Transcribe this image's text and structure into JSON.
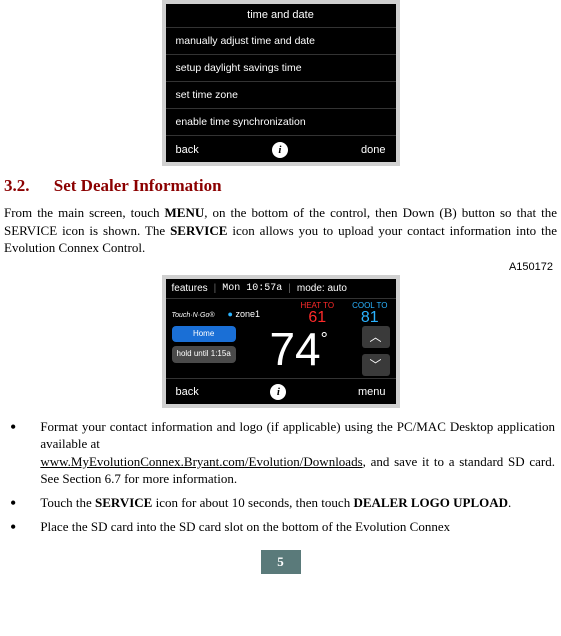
{
  "screenshot1": {
    "header": "time and date",
    "rows": [
      "manually adjust time and date",
      "setup daylight savings time",
      "set time zone",
      "enable time synchronization"
    ],
    "back": "back",
    "done": "done",
    "info_icon": "i"
  },
  "section": {
    "num": "3.2.",
    "title": "Set Dealer Information"
  },
  "para": {
    "p1a": "From the main screen, touch ",
    "p1b": "MENU",
    "p1c": ", on the bottom of the control, then Down (B) button so that the SERVICE icon is shown. The ",
    "p1d": "SERVICE",
    "p1e": " icon allows you to upload your contact information into the Evolution Connex Control."
  },
  "figref": "A150172",
  "screenshot2": {
    "features": "features",
    "clock": "Mon 10:57a",
    "mode_label": "mode: auto",
    "touchngo": "Touch·N·Go®",
    "zone_dot": "●",
    "zone": "zone1",
    "heat_label": "HEAT TO",
    "heat_val": "61",
    "cool_label": "COOL TO",
    "cool_val": "81",
    "home": "Home",
    "hold": "hold until 1:15a",
    "temp": "74",
    "deg": "°",
    "chev_up": "︿",
    "chev_down": "﹀",
    "back": "back",
    "info_icon": "i",
    "menu": "menu"
  },
  "bullets": {
    "b1a": "Format your contact information and logo (if applicable) using the PC/MAC Desktop application available at ",
    "b1b_link": "www.MyEvolutionConnex.Bryant.com/Evolution/Downloads",
    "b1c": ", and save it to a standard SD card. See Section 6.7 for more information.",
    "b2a": "Touch the ",
    "b2b": "SERVICE",
    "b2c": " icon for about 10 seconds, then touch ",
    "b2d": "DEALER LOGO UPLOAD",
    "b2e": ".",
    "b3": "Place the SD card into the SD card slot on the bottom of the Evolution Connex"
  },
  "page": "5"
}
